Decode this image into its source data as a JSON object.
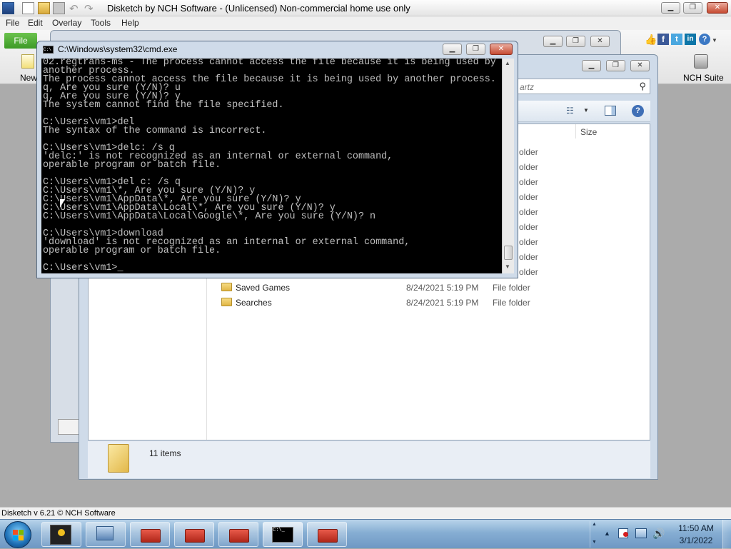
{
  "app": {
    "title": "Disketch by NCH Software - (Unlicensed) Non-commercial home use only",
    "menu": [
      "File",
      "Edit",
      "Overlay",
      "Tools",
      "Help"
    ],
    "file_tab": "File",
    "ribbon_new_label": "New",
    "ribbon_nch_suite_label": "NCH Suite",
    "status": "Disketch v 6.21 © NCH Software",
    "colors": {
      "file_tab": "#4caf34",
      "titlebar": "#f0f0f0"
    }
  },
  "cmd": {
    "title": "C:\\Windows\\system32\\cmd.exe",
    "lines": [
      "02.regtrans-ms - The process cannot access the file because it is being used by",
      "another process.",
      "The process cannot access the file because it is being used by another process.",
      "q, Are you sure (Y/N)? u",
      "q, Are you sure (Y/N)? y",
      "The system cannot find the file specified.",
      "",
      "C:\\Users\\vm1>del",
      "The syntax of the command is incorrect.",
      "",
      "C:\\Users\\vm1>delc: /s q",
      "'delc:' is not recognized as an internal or external command,",
      "operable program or batch file.",
      "",
      "C:\\Users\\vm1>del c: /s q",
      "C:\\Users\\vm1\\*, Are you sure (Y/N)? y",
      "C:\\Users\\vm1\\AppData\\*, Are you sure (Y/N)? y",
      "C:\\Users\\vm1\\AppData\\Local\\*, Are you sure (Y/N)? y",
      "C:\\Users\\vm1\\AppData\\Local\\Google\\*, Are you sure (Y/N)? n",
      "",
      "C:\\Users\\vm1>download",
      "'download' is not recognized as an internal or external command,",
      "operable program or batch file.",
      "",
      "C:\\Users\\vm1>_"
    ]
  },
  "explorer": {
    "search_placeholder": "artz",
    "column_size": "Size",
    "partial_type": "older",
    "rows": [
      {
        "name": "Saved Games",
        "date": "8/24/2021 5:19 PM",
        "type": "File folder"
      },
      {
        "name": "Searches",
        "date": "8/24/2021 5:19 PM",
        "type": "File folder"
      }
    ],
    "items_count": "11 items"
  },
  "taskbar": {
    "time": "11:50 AM",
    "date": "3/1/2022"
  }
}
